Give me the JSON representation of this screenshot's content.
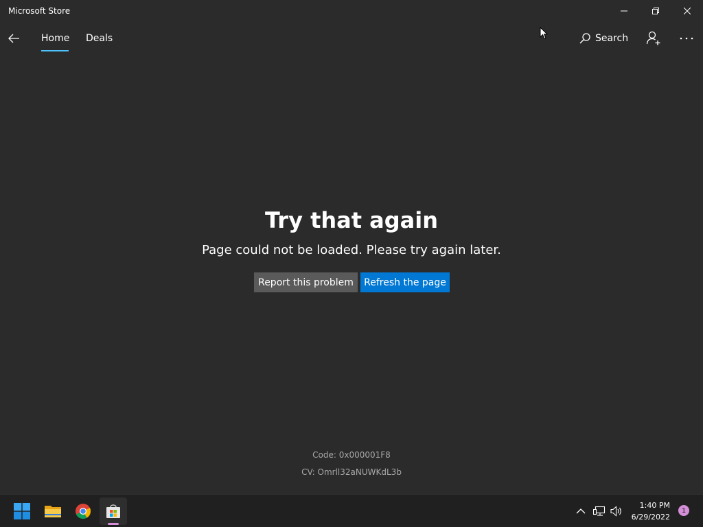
{
  "window": {
    "title": "Microsoft Store",
    "controls": [
      "minimize-icon",
      "restore-icon",
      "close-icon"
    ]
  },
  "nav": {
    "back_icon": "back-arrow-icon",
    "tabs": [
      {
        "label": "Home",
        "selected": true
      },
      {
        "label": "Deals",
        "selected": false
      }
    ],
    "search_label": "Search",
    "search_icon": "search-icon",
    "account_icon": "add-account-icon",
    "more_icon": "more-icon"
  },
  "error": {
    "title": "Try that again",
    "message": "Page could not be loaded. Please try again later.",
    "report_label": "Report this problem",
    "refresh_label": "Refresh the page",
    "code_line": "Code: 0x000001F8",
    "cv_line": "CV: Omrll32aNUWKdL3b"
  },
  "taskbar": {
    "pinned": [
      "windows-start-icon",
      "file-explorer-icon",
      "chrome-icon",
      "microsoft-store-icon"
    ],
    "time": "1:40 PM",
    "date": "6/29/2022",
    "notification_count": "1"
  },
  "colors": {
    "background": "#2b2b2b",
    "accent": "#0078d4",
    "tab_indicator": "#4cc2ff",
    "secondary_button": "#5a5a5a",
    "taskbar": "#202020"
  }
}
